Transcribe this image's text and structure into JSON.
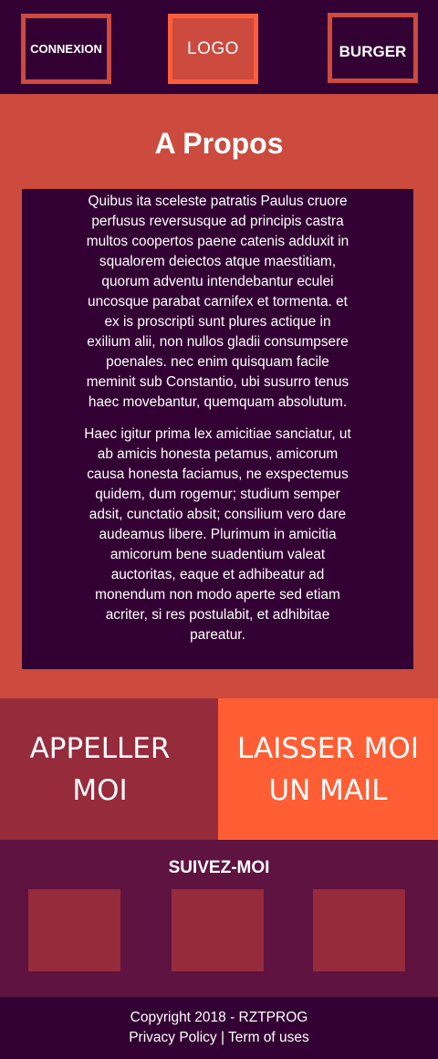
{
  "header": {
    "connexion_label": "CONNEXION",
    "logo_label": "LOGO",
    "burger_label": "BURGER"
  },
  "about": {
    "title": "A Propos",
    "paragraph1": "Quibus ita sceleste patratis Paulus cruore perfusus reversusque ad principis castra multos coopertos paene catenis adduxit in squalorem deiectos atque maestitiam, quorum adventu intendebantur eculei uncosque parabat carnifex et tormenta. et ex is proscripti sunt plures actique in exilium alii, non nullos gladii consumpsere poenales. nec enim quisquam facile meminit sub Constantio, ubi susurro tenus haec movebantur, quemquam absolutum.",
    "paragraph2": "Haec igitur prima lex amicitiae sanciatur, ut ab amicis honesta petamus, amicorum causa honesta faciamus, ne exspectemus quidem, dum rogemur; studium semper adsit, cunctatio absit; consilium vero dare audeamus libere. Plurimum in amicitia amicorum bene suadentium valeat auctoritas, eaque et adhibeatur ad monendum non modo aperte sed etiam acriter, si res postulabit, et adhibitae pareatur."
  },
  "cta": {
    "call_label": "APPELLER MOI",
    "mail_label": "LAISSER MOI UN MAIL"
  },
  "social": {
    "title": "SUIVEZ-MOI"
  },
  "footer": {
    "copyright": "Copyright 2018 - RZTPROG",
    "privacy": "Privacy Policy",
    "separator": " | ",
    "terms": "Term of uses"
  },
  "colors": {
    "dark_purple": "#330033",
    "coral_red": "#CC4A3E",
    "orange": "#FF5E34",
    "wine": "#962B3C",
    "plum": "#5E1341"
  }
}
